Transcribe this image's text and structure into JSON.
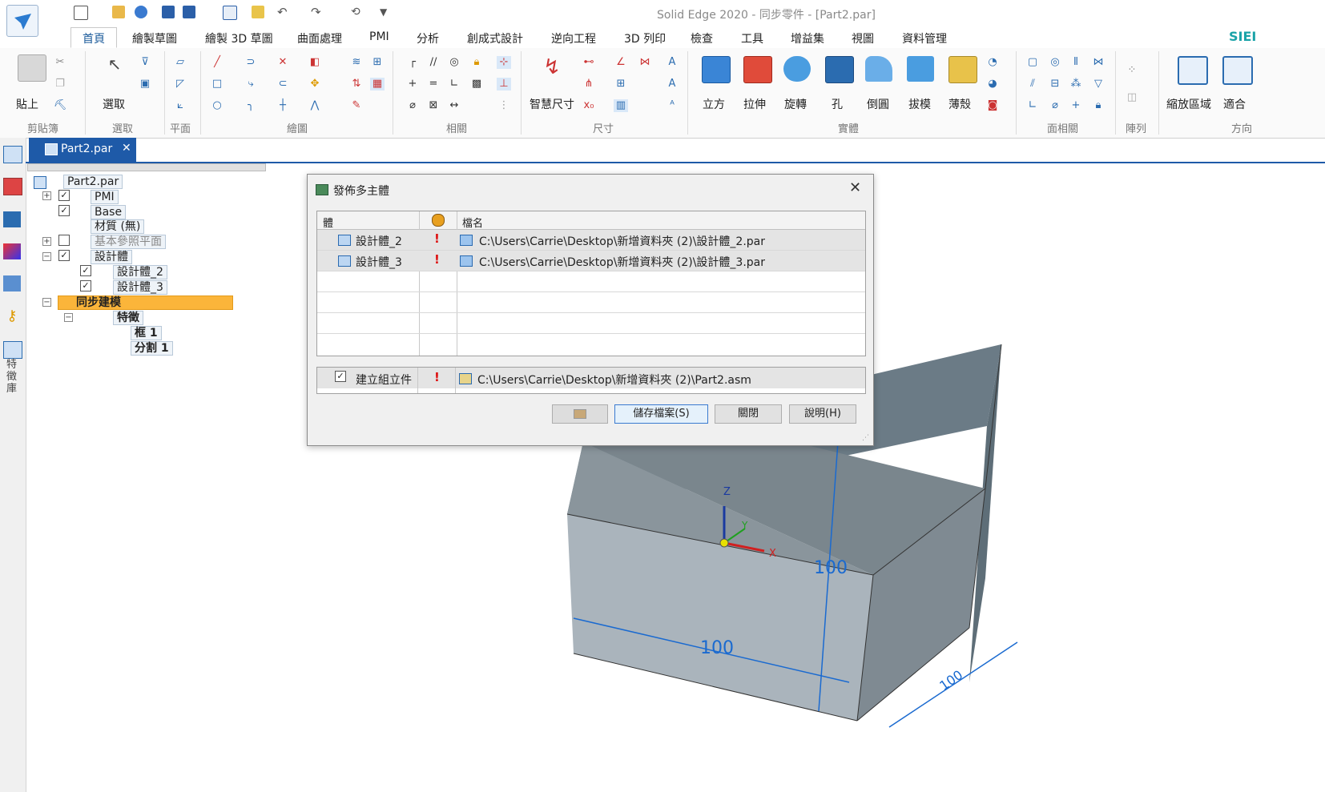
{
  "window": {
    "title": "Solid Edge 2020 - 同步零件 - [Part2.par]"
  },
  "brand": "SIEI",
  "tabs": [
    "首頁",
    "繪製草圖",
    "繪製 3D 草圖",
    "曲面處理",
    "PMI",
    "分析",
    "創成式設計",
    "逆向工程",
    "3D 列印",
    "檢查",
    "工具",
    "增益集",
    "視圖",
    "資料管理"
  ],
  "ribbon": {
    "groups": [
      "剪貼簿",
      "選取",
      "平面",
      "繪圖",
      "相關",
      "尺寸",
      "實體",
      "面相關",
      "陣列",
      "方向"
    ],
    "big_buttons": [
      "貼上",
      "選取",
      "智慧尺寸",
      "立方",
      "拉伸",
      "旋轉",
      "孔",
      "倒圓",
      "拔模",
      "薄殼",
      "縮放區域",
      "適合"
    ]
  },
  "doc_tab": {
    "label": "Part2.par",
    "close": "✕"
  },
  "tree": {
    "root": "Part2.par",
    "pmi": "PMI",
    "base": "Base",
    "material": "材質 (無)",
    "ref_planes": "基本參照平面",
    "design_body": "設計體",
    "body2": "設計體_2",
    "body3": "設計體_3",
    "sync": "同步建模",
    "features": "特徵",
    "frame": "框 1",
    "split": "分割 1"
  },
  "left_strip_label": "特徵庫",
  "dialog": {
    "title": "發佈多主體",
    "columns": [
      "體",
      "",
      "檔名"
    ],
    "rows": [
      {
        "body": "設計體_2",
        "file": "C:\\Users\\Carrie\\Desktop\\新增資料夾 (2)\\設計體_2.par"
      },
      {
        "body": "設計體_3",
        "file": "C:\\Users\\Carrie\\Desktop\\新增資料夾 (2)\\設計體_3.par"
      }
    ],
    "assembly": {
      "label": "建立組立件",
      "file": "C:\\Users\\Carrie\\Desktop\\新增資料夾 (2)\\Part2.asm",
      "checked": true
    },
    "buttons": {
      "save": "儲存檔案(S)",
      "close": "關閉",
      "help": "說明(H)"
    }
  },
  "viewport": {
    "dim1": "100",
    "dim2": "100",
    "dim3": "100",
    "axis_x": "X",
    "axis_y": "Y",
    "axis_z": "Z"
  }
}
